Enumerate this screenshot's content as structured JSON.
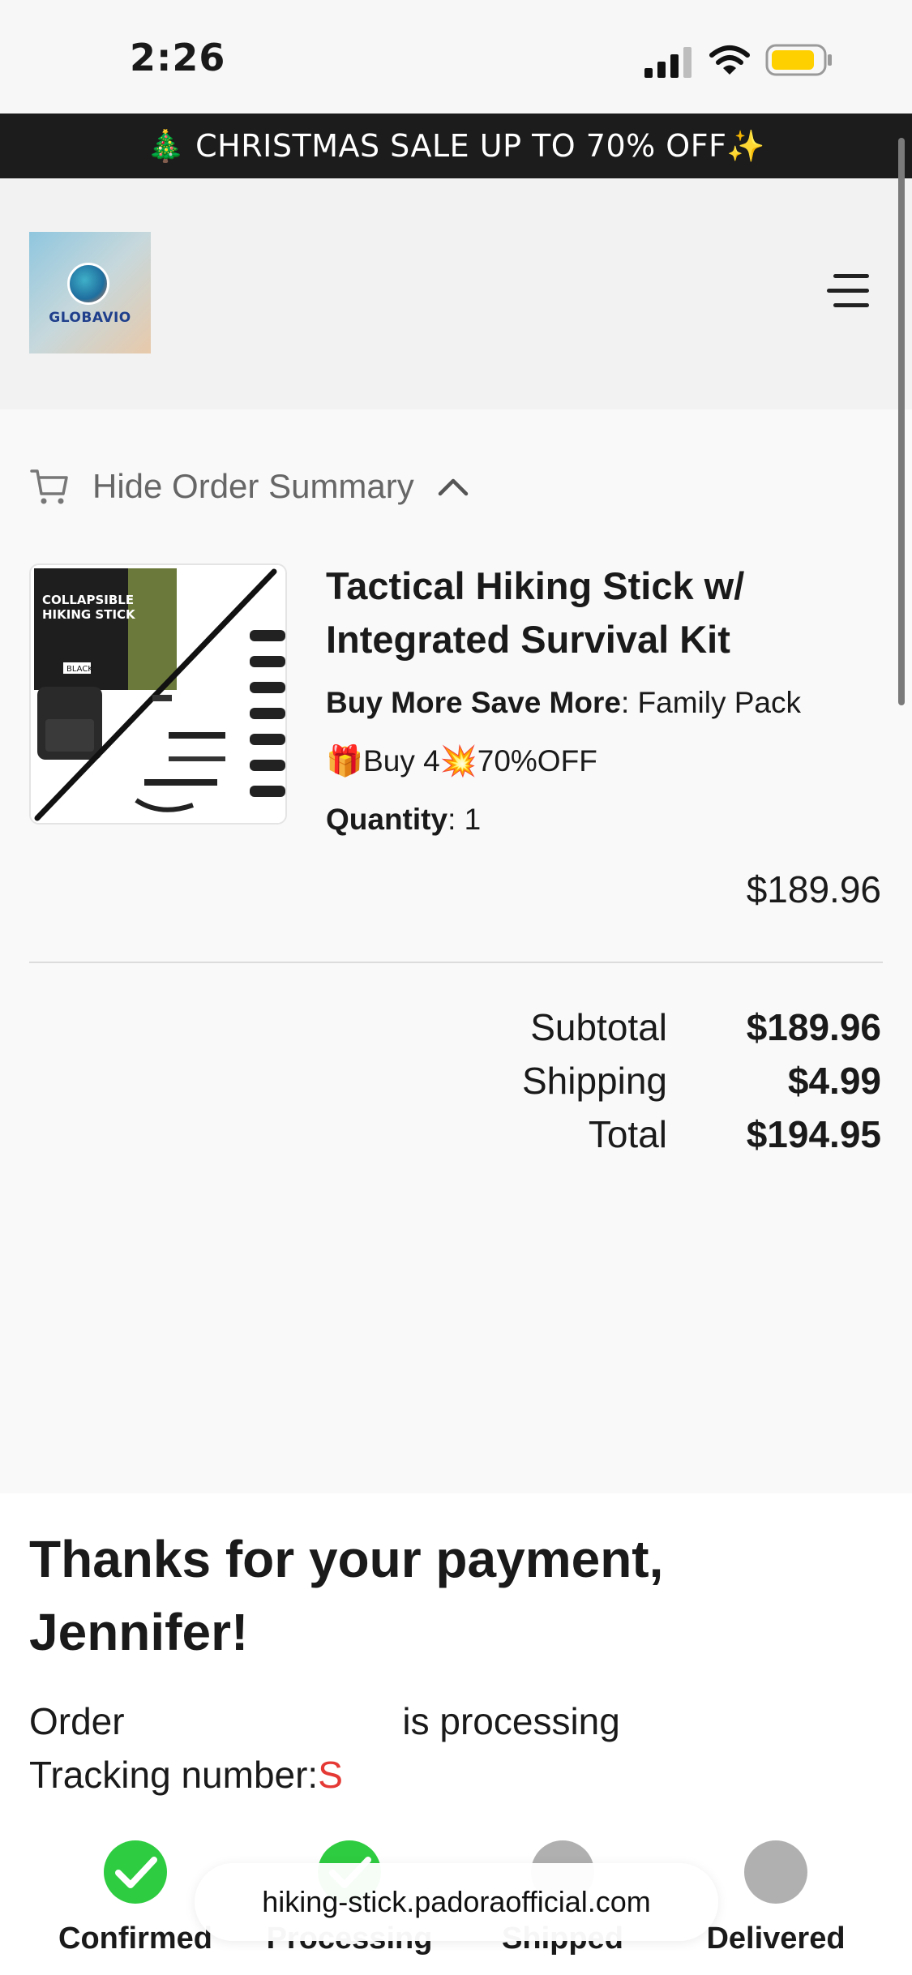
{
  "status_bar": {
    "time": "2:26"
  },
  "promo": {
    "text": "🎄 CHRISTMAS SALE UP TO 70% OFF✨"
  },
  "header": {
    "logo_text": "GLOBAVIO"
  },
  "order_summary": {
    "toggle_label": "Hide Order Summary"
  },
  "product": {
    "title": "Tactical Hiking Stick w/ Integrated Survival Kit",
    "image_box_text": "COLLAPSIBLE HIKING STICK",
    "image_tag": "BLACK",
    "option_label": "Buy More Save More",
    "option_value": ": Family Pack",
    "offer": "🎁Buy 4💥70%OFF",
    "quantity_label": "Quantity",
    "quantity_value": ": 1",
    "price": "$189.96"
  },
  "totals": {
    "subtotal_label": "Subtotal",
    "subtotal_value": "$189.96",
    "shipping_label": "Shipping",
    "shipping_value": "$4.99",
    "total_label": "Total",
    "total_value": "$194.95"
  },
  "thanks": {
    "title": "Thanks for your payment, Jennifer!",
    "order_prefix": "Order ",
    "order_suffix": "is processing",
    "tracking_label": "Tracking number:",
    "tracking_value": "S"
  },
  "steps": [
    {
      "label": "Confirmed",
      "color": "#2ecc40"
    },
    {
      "label": "Processing",
      "color": "#2ecc40"
    },
    {
      "label": "Shipped",
      "color": "#b0b0b0"
    },
    {
      "label": "Delivered",
      "color": "#b0b0b0"
    }
  ],
  "browser": {
    "url": "hiking-stick.padoraofficial.com"
  },
  "icons": {
    "cart": "cart-icon",
    "menu": "hamburger-menu-icon",
    "chevron": "chevron-up-icon",
    "check": "check-icon",
    "signal": "cellular-signal-icon",
    "wifi": "wifi-icon",
    "battery": "battery-icon"
  },
  "colors": {
    "accent_green": "#2ecc40",
    "tracking_red": "#e53935",
    "promo_bg": "#1c1c1c",
    "battery_fill": "#ffd000"
  }
}
